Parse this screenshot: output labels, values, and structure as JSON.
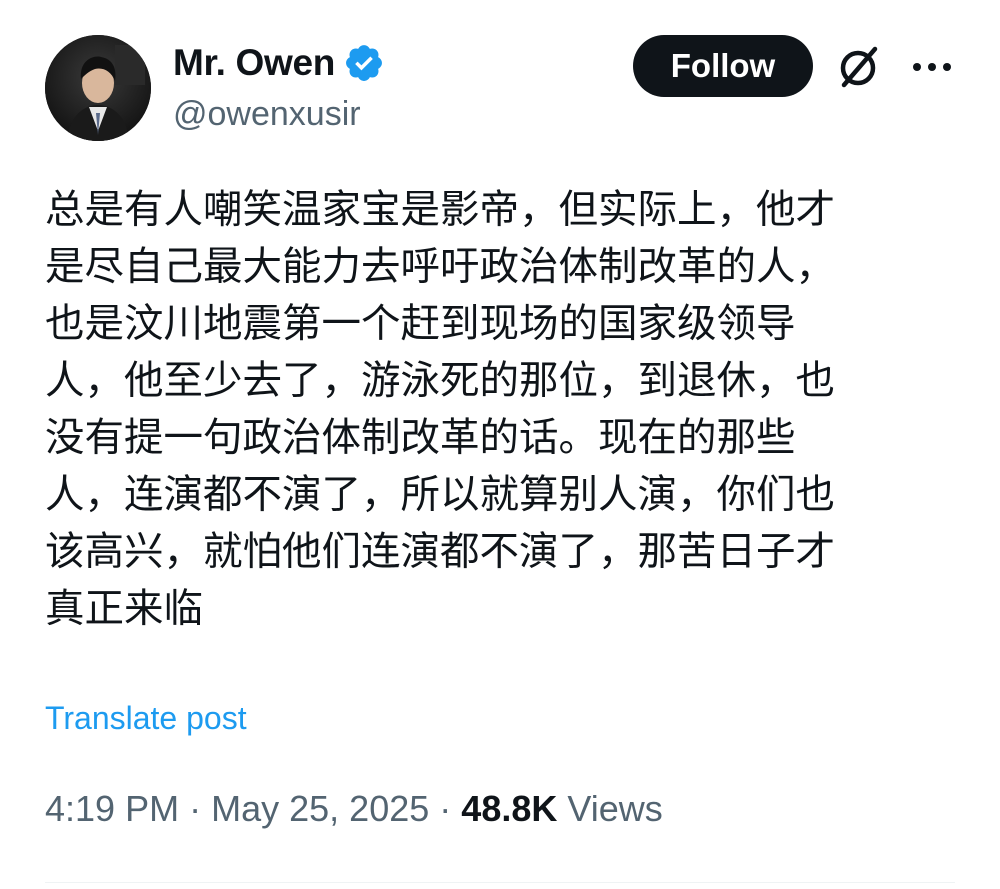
{
  "author": {
    "display_name": "Mr. Owen",
    "handle": "@owenxusir",
    "verified_color": "#1d9bf0"
  },
  "actions": {
    "follow_label": "Follow",
    "grok_icon": "grok-icon",
    "more_icon": "more-icon"
  },
  "tweet": {
    "lines": [
      "总是有人嘲笑温家宝是影帝，但实际上，他才",
      "是尽自己最大能力去呼吁政治体制改革的人，",
      "也是汶川地震第一个赶到现场的国家级领导",
      "人，他至少去了，游泳死的那位，到退休，也",
      "没有提一句政治体制改革的话。现在的那些",
      "人，连演都不演了，所以就算别人演，你们也",
      "该高兴，就怕他们连演都不演了，那苦日子才",
      "真正来临"
    ],
    "translate_label": "Translate post"
  },
  "meta": {
    "time": "4:19 PM",
    "separator": "·",
    "date": "May 25, 2025",
    "views_count": "48.8K",
    "views_label": "Views"
  },
  "colors": {
    "text": "#0f1419",
    "secondary": "#536471",
    "link": "#1d9bf0"
  }
}
